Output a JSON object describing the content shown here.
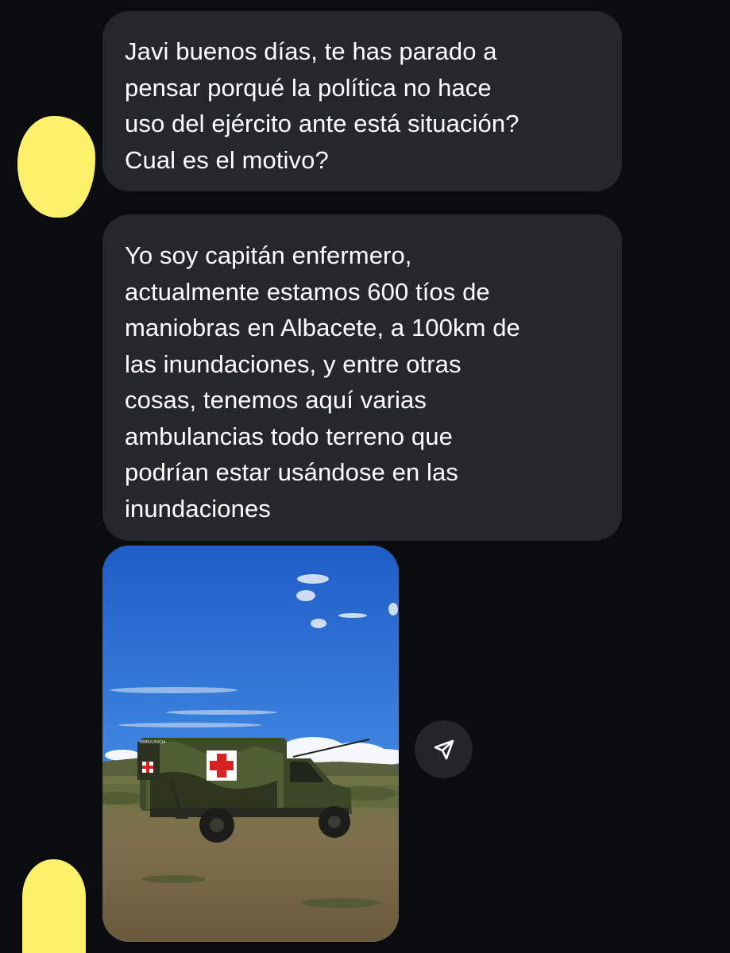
{
  "messages": [
    {
      "text": "Javi buenos días, te has parado a\npensar porqué la política no hace\nuso del ejército ante está situación?\nCual es el motivo?"
    },
    {
      "text": "Yo soy capitán enfermero,\nactualmente estamos 600 tíos de\nmaniobras en Albacete, a 100km de\nlas inundaciones, y entre otras\ncosas, tenemos aquí varias\nambulancias todo terreno que\npodrían estar usándose en las\ninundaciones"
    }
  ],
  "photo": {
    "vehicle_marking": "AMBULANCIA"
  },
  "icons": {
    "share": "paper-plane-icon"
  },
  "colors": {
    "background": "#0b0c10",
    "bubble": "#26272d",
    "redaction": "#fbf16a"
  }
}
